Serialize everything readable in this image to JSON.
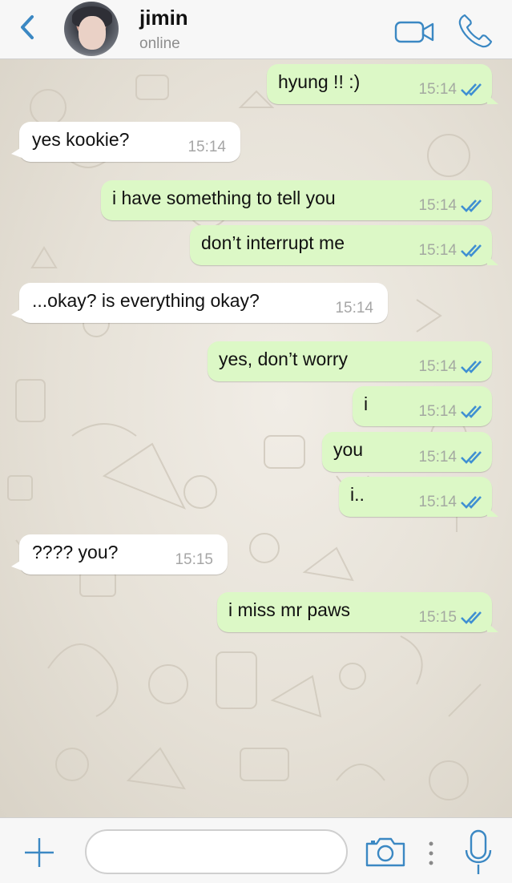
{
  "header": {
    "contact_name": "jimin",
    "status": "online",
    "back_icon": "chevron-left-icon",
    "video_icon": "video-camera-icon",
    "call_icon": "phone-icon"
  },
  "colors": {
    "accent": "#3b88c3",
    "outgoing_bubble": "#dcf8c6",
    "incoming_bubble": "#ffffff",
    "read_ticks": "#3f8fd2"
  },
  "messages": [
    {
      "direction": "out",
      "text": "hyung !! :)",
      "time": "15:14"
    },
    {
      "direction": "in",
      "text": "yes kookie?",
      "time": "15:14"
    },
    {
      "direction": "out",
      "text": "i have something to tell you",
      "time": "15:14"
    },
    {
      "direction": "out",
      "text": "don’t interrupt me",
      "time": "15:14"
    },
    {
      "direction": "in",
      "text": "...okay? is everything okay?",
      "time": "15:14"
    },
    {
      "direction": "out",
      "text": "yes, don’t worry",
      "time": "15:14"
    },
    {
      "direction": "out",
      "text": "i",
      "time": "15:14"
    },
    {
      "direction": "out",
      "text": "you",
      "time": "15:14"
    },
    {
      "direction": "out",
      "text": "i..",
      "time": "15:14"
    },
    {
      "direction": "in",
      "text": "???? you?",
      "time": "15:15"
    },
    {
      "direction": "out",
      "text": "i miss mr paws",
      "time": "15:15"
    }
  ],
  "input_bar": {
    "plus_icon": "plus-icon",
    "message_value": "",
    "camera_icon": "camera-icon",
    "more_icon": "vertical-dots-icon",
    "mic_icon": "microphone-icon"
  }
}
